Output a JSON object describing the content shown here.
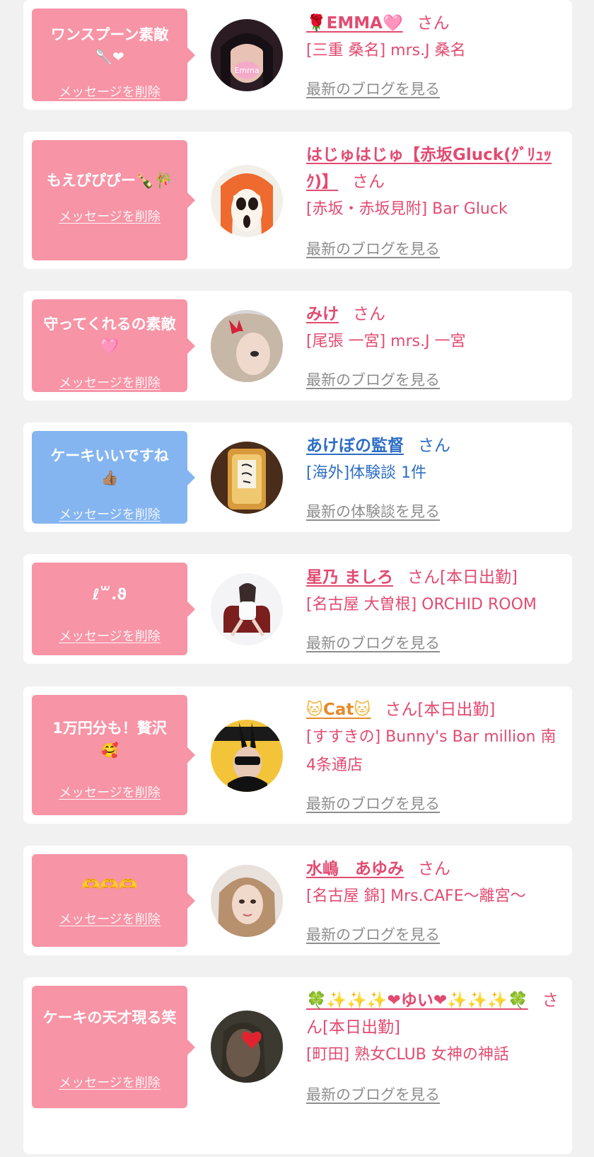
{
  "common": {
    "delete_label": "メッセージを削除",
    "blog_label": "最新のブログを見る",
    "report_label": "最新の体験談を見る",
    "honorific": "さん"
  },
  "cards": [
    {
      "message": "ワンスプーン素敵",
      "message_icons": "🥄❤",
      "name_prefix": "🌹",
      "name": "EMMA",
      "name_suffix": "🩷",
      "status": "",
      "shop": "[三重 桑名] mrs.J 桑名"
    },
    {
      "message": "もえぴぴぴー🍾🎋",
      "name": "はじゅはじゅ【赤坂Gluck(ｸﾞﾘｭｯｸ)】",
      "status": "",
      "shop": "[赤坂・赤坂見附] Bar Gluck"
    },
    {
      "message": "守ってくれるの素敵🩷",
      "name": "みけ",
      "status": "",
      "shop": "[尾張 一宮] mrs.J 一宮"
    },
    {
      "message": "ケーキいいですね",
      "message_icons": "👍🏽",
      "name": "あけぼの監督",
      "status": "",
      "shop": "[海外]体験談 1件"
    },
    {
      "message": "ℓ꒳.ϑ",
      "name": "星乃 ましろ",
      "status": "[本日出勤]",
      "shop": "[名古屋 大曽根] ORCHID ROOM"
    },
    {
      "message": "1万円分も！贅沢",
      "message_icons": "🥰",
      "name_prefix": "🐱",
      "name": "Cat",
      "name_suffix": "🐱",
      "status": "[本日出勤]",
      "shop": "[すすきの] Bunny's Bar million 南4条通店"
    },
    {
      "message": "🫶🫶🫶",
      "name": "水嶋　あゆみ",
      "status": "",
      "shop": "[名古屋 錦] Mrs.CAFE〜離宮〜"
    },
    {
      "message": "ケーキの天才現る笑",
      "name": "🍀✨✨✨❤ゆい❤✨✨✨🍀",
      "status": "[本日出勤]",
      "shop": "[町田] 熟女CLUB 女神の神話"
    }
  ],
  "avatar_badge": "Emma",
  "colors": {
    "pink_bubble": "#f794a6",
    "blue_bubble": "#84b5f1",
    "pink_text": "#e24b71",
    "blue_text": "#2d6ec4",
    "link_gray": "#8d8d8d",
    "background": "#f1f1f1"
  }
}
